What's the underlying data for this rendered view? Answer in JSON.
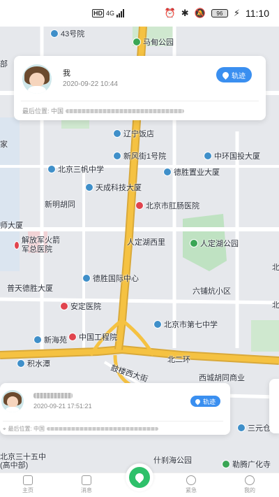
{
  "status_bar": {
    "hd": "HD",
    "network": "4G",
    "battery": "96",
    "time": "11:10"
  },
  "map": {
    "pois": [
      {
        "name": "43号院",
        "kind": "blue"
      },
      {
        "name": "马甸公园",
        "kind": "green"
      },
      {
        "name": "辽宁饭店",
        "kind": "blue"
      },
      {
        "name": "新风街1号院",
        "kind": "blue"
      },
      {
        "name": "中环国投大厦",
        "kind": "blue"
      },
      {
        "name": "北京三帆中学",
        "kind": "blue"
      },
      {
        "name": "德胜置业大厦",
        "kind": "blue"
      },
      {
        "name": "天成科技大厦",
        "kind": "blue"
      },
      {
        "name": "新明胡同",
        "kind": "blue"
      },
      {
        "name": "北京市肛肠医院",
        "kind": "red"
      },
      {
        "name": "人定湖西里",
        "kind": "blue"
      },
      {
        "name": "人定湖公园",
        "kind": "green"
      },
      {
        "name": "解放军火箭军总医院",
        "kind": "red"
      },
      {
        "name": "德胜国际中心",
        "kind": "blue"
      },
      {
        "name": "普天德胜大厦",
        "kind": "blue"
      },
      {
        "name": "六铺炕小区",
        "kind": "blue"
      },
      {
        "name": "安定医院",
        "kind": "red"
      },
      {
        "name": "北京市第七中学",
        "kind": "blue"
      },
      {
        "name": "新海苑",
        "kind": "blue"
      },
      {
        "name": "中国工程院",
        "kind": "red"
      },
      {
        "name": "积水潭",
        "kind": "blue"
      },
      {
        "name": "北二环",
        "kind": "road"
      },
      {
        "name": "鼓楼西大街",
        "kind": "road"
      },
      {
        "name": "西城胡同商业",
        "kind": "blue"
      },
      {
        "name": "三元仓",
        "kind": "blue"
      },
      {
        "name": "北京三十五中(高中部)",
        "kind": "blue"
      },
      {
        "name": "什刹海公园",
        "kind": "green"
      },
      {
        "name": "勒腾广化寺",
        "kind": "green"
      },
      {
        "name": "北",
        "kind": "blue"
      },
      {
        "name": "北",
        "kind": "blue"
      },
      {
        "name": "师大厦",
        "kind": "blue"
      },
      {
        "name": "部",
        "kind": "blue"
      },
      {
        "name": "家",
        "kind": "blue"
      }
    ]
  },
  "card_self": {
    "name": "我",
    "timestamp": "2020-09-22 10:44",
    "track_label": "轨迹",
    "last_position_label": "最后位置: 中国"
  },
  "card_member": {
    "timestamp": "2020-09-21 17:51:21",
    "track_label": "轨迹",
    "last_position_label": "最后位置: 中国"
  },
  "bottom_nav": {
    "home": "主页",
    "messages": "消息",
    "emergency": "紧急",
    "mine": "我的"
  },
  "colors": {
    "accent": "#3a8ff0",
    "center": "#2ec06a",
    "road_main": "#f5c242"
  }
}
